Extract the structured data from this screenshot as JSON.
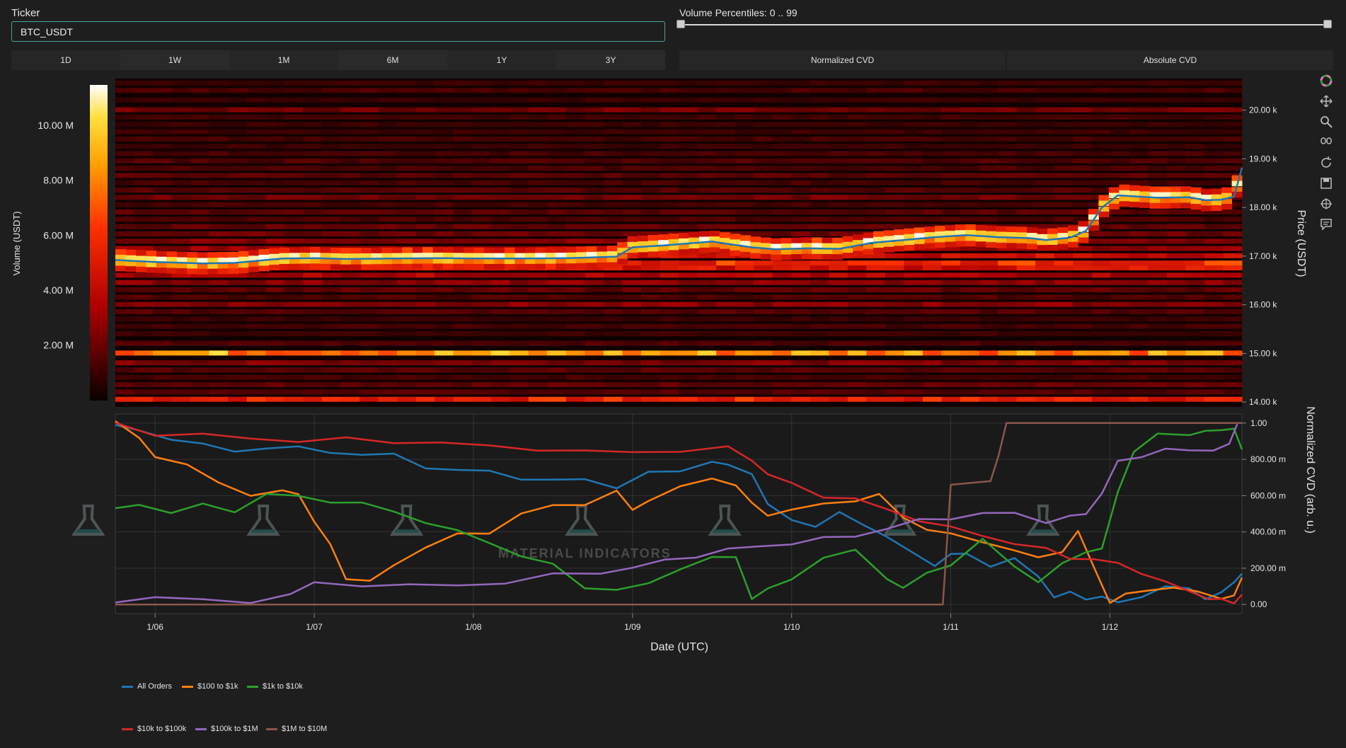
{
  "ticker": {
    "label": "Ticker",
    "value": "BTC_USDT"
  },
  "time_ranges": [
    "1D",
    "1W",
    "1M",
    "6M",
    "1Y",
    "3Y"
  ],
  "volume_percentiles": {
    "label": "Volume Percentiles: 0 .. 99",
    "min": 0,
    "max": 99
  },
  "cvd_modes": [
    "Normalized CVD",
    "Absolute CVD"
  ],
  "modebar_icons": [
    "plotly-logo-icon",
    "pan-icon",
    "zoom-icon",
    "autoscale-icon",
    "reset-icon",
    "download-icon",
    "spike-icon",
    "hover-icon"
  ],
  "colors": {
    "blue": "#1f77b4",
    "orange": "#ff7f0e",
    "green": "#2ca02c",
    "red": "#d62728",
    "purple": "#9467bd",
    "brown": "#8c564b"
  },
  "chart_data": [
    {
      "type": "heatmap",
      "colorbar_title": "Volume (USDT)",
      "colorbar_ticks": [
        "2.00 M",
        "4.00 M",
        "6.00 M",
        "8.00 M",
        "10.00 M"
      ],
      "colorbar_tick_values": [
        2,
        4,
        6,
        8,
        10
      ],
      "colorbar_range": [
        0,
        11.5
      ],
      "colorscale": "hot",
      "ylabel": "Price (USDT)",
      "y_ticks": [
        "14.00 k",
        "15.00 k",
        "16.00 k",
        "17.00 k",
        "18.00 k",
        "19.00 k",
        "20.00 k"
      ],
      "y_tick_values": [
        14000,
        15000,
        16000,
        17000,
        18000,
        19000,
        20000
      ],
      "ylim": [
        13900,
        20650
      ],
      "xlim": [
        5.75,
        12.83
      ],
      "price_line": {
        "color": "#1f77b4",
        "x": [
          5.75,
          6.0,
          6.3,
          6.5,
          6.7,
          6.8,
          7.0,
          7.2,
          7.5,
          7.8,
          8.0,
          8.3,
          8.6,
          8.9,
          9.0,
          9.2,
          9.5,
          9.75,
          9.9,
          10.1,
          10.3,
          10.5,
          10.7,
          10.9,
          11.1,
          11.3,
          11.5,
          11.6,
          11.75,
          11.85,
          11.95,
          12.05,
          12.3,
          12.5,
          12.6,
          12.7,
          12.78,
          12.83
        ],
        "y": [
          16920,
          16880,
          16850,
          16860,
          16920,
          16950,
          16960,
          16940,
          16950,
          16960,
          16950,
          16950,
          16960,
          16990,
          17180,
          17220,
          17300,
          17180,
          17140,
          17160,
          17150,
          17270,
          17330,
          17390,
          17430,
          17390,
          17370,
          17330,
          17380,
          17520,
          18000,
          18250,
          18200,
          18210,
          18150,
          18160,
          18220,
          18820
        ]
      },
      "bands": [
        {
          "y": 14050,
          "v": 5.5
        },
        {
          "y": 14200,
          "v": 1.5
        },
        {
          "y": 14350,
          "v": 1.8
        },
        {
          "y": 14500,
          "v": 1.2
        },
        {
          "y": 14650,
          "v": 1.6
        },
        {
          "y": 14800,
          "v": 2.4
        },
        {
          "y": 15000,
          "v": 8.5
        },
        {
          "y": 15200,
          "v": 1.4
        },
        {
          "y": 15400,
          "v": 1.0
        },
        {
          "y": 15550,
          "v": 1.2
        },
        {
          "y": 15700,
          "v": 1.0
        },
        {
          "y": 15850,
          "v": 1.5
        },
        {
          "y": 16000,
          "v": 2.6
        },
        {
          "y": 16150,
          "v": 1.4
        },
        {
          "y": 16300,
          "v": 1.8
        },
        {
          "y": 16450,
          "v": 2.6
        },
        {
          "y": 16600,
          "v": 3.4
        },
        {
          "y": 16750,
          "v": 4.6
        },
        {
          "y": 16850,
          "v": 5.8
        },
        {
          "y": 17000,
          "v": 4.2
        },
        {
          "y": 17150,
          "v": 2.8
        },
        {
          "y": 17300,
          "v": 2.4
        },
        {
          "y": 17450,
          "v": 2.0
        },
        {
          "y": 17600,
          "v": 1.8
        },
        {
          "y": 17750,
          "v": 1.4
        },
        {
          "y": 17900,
          "v": 1.6
        },
        {
          "y": 18050,
          "v": 1.2
        },
        {
          "y": 18200,
          "v": 2.2
        },
        {
          "y": 18350,
          "v": 1.5
        },
        {
          "y": 18500,
          "v": 1.2
        },
        {
          "y": 18650,
          "v": 1.6
        },
        {
          "y": 18800,
          "v": 1.3
        },
        {
          "y": 18950,
          "v": 1.4
        },
        {
          "y": 19100,
          "v": 1.2
        },
        {
          "y": 19250,
          "v": 1.0
        },
        {
          "y": 19400,
          "v": 1.2
        },
        {
          "y": 19550,
          "v": 1.0
        },
        {
          "y": 19700,
          "v": 1.0
        },
        {
          "y": 19850,
          "v": 1.1
        },
        {
          "y": 20000,
          "v": 2.2
        },
        {
          "y": 20200,
          "v": 1.0
        },
        {
          "y": 20400,
          "v": 1.3
        },
        {
          "y": 20550,
          "v": 1.0
        }
      ]
    },
    {
      "type": "line",
      "ylabel": "Normalized CVD (arb. u.)",
      "xlabel": "Date (UTC)",
      "x_ticks": [
        "1/06",
        "1/07",
        "1/08",
        "1/09",
        "1/10",
        "1/11",
        "1/12"
      ],
      "x_tick_values": [
        6,
        7,
        8,
        9,
        10,
        11,
        12
      ],
      "xlim": [
        5.75,
        12.83
      ],
      "y_ticks": [
        "0.00",
        "200.00 m",
        "400.00 m",
        "600.00 m",
        "800.00 m",
        "1.00"
      ],
      "y_tick_values": [
        0,
        0.2,
        0.4,
        0.6,
        0.8,
        1.0
      ],
      "ylim": [
        -0.05,
        1.05
      ],
      "series": [
        {
          "name": "All Orders",
          "color": "#1f77b4",
          "x": [
            5.75,
            5.9,
            6.1,
            6.3,
            6.5,
            6.7,
            6.9,
            7.1,
            7.3,
            7.5,
            7.7,
            7.9,
            8.1,
            8.3,
            8.5,
            8.7,
            8.9,
            9.1,
            9.3,
            9.5,
            9.6,
            9.75,
            9.85,
            10.0,
            10.15,
            10.3,
            10.45,
            10.6,
            10.75,
            10.9,
            11.0,
            11.1,
            11.25,
            11.4,
            11.55,
            11.65,
            11.75,
            11.85,
            11.95,
            12.05,
            12.2,
            12.35,
            12.5,
            12.6,
            12.7,
            12.78,
            12.83
          ],
          "y": [
            0.99,
            0.95,
            0.92,
            0.88,
            0.84,
            0.87,
            0.86,
            0.84,
            0.83,
            0.82,
            0.76,
            0.74,
            0.73,
            0.7,
            0.68,
            0.69,
            0.65,
            0.72,
            0.74,
            0.79,
            0.76,
            0.73,
            0.55,
            0.46,
            0.44,
            0.5,
            0.44,
            0.38,
            0.28,
            0.22,
            0.28,
            0.27,
            0.22,
            0.25,
            0.15,
            0.05,
            0.06,
            0.03,
            0.05,
            0.0,
            0.05,
            0.1,
            0.08,
            0.04,
            0.06,
            0.12,
            0.18
          ]
        },
        {
          "name": "$100 to $1k",
          "color": "#ff7f0e",
          "x": [
            5.75,
            5.9,
            6.0,
            6.2,
            6.4,
            6.6,
            6.8,
            6.9,
            7.0,
            7.1,
            7.2,
            7.35,
            7.5,
            7.7,
            7.9,
            8.1,
            8.3,
            8.5,
            8.7,
            8.9,
            9.0,
            9.1,
            9.3,
            9.5,
            9.65,
            9.75,
            9.85,
            10.0,
            10.2,
            10.4,
            10.55,
            10.7,
            10.85,
            11.0,
            11.2,
            11.4,
            11.55,
            11.7,
            11.8,
            11.9,
            12.0,
            12.1,
            12.25,
            12.4,
            12.55,
            12.7,
            12.78,
            12.83
          ],
          "y": [
            1.0,
            0.92,
            0.82,
            0.76,
            0.68,
            0.6,
            0.62,
            0.62,
            0.45,
            0.33,
            0.15,
            0.12,
            0.22,
            0.32,
            0.38,
            0.4,
            0.5,
            0.54,
            0.56,
            0.62,
            0.52,
            0.58,
            0.64,
            0.7,
            0.66,
            0.55,
            0.5,
            0.52,
            0.55,
            0.58,
            0.6,
            0.48,
            0.42,
            0.38,
            0.35,
            0.3,
            0.25,
            0.3,
            0.4,
            0.2,
            0.02,
            0.05,
            0.08,
            0.1,
            0.06,
            0.04,
            0.05,
            0.14
          ]
        },
        {
          "name": "$1k to $10k",
          "color": "#2ca02c",
          "x": [
            5.75,
            5.9,
            6.1,
            6.3,
            6.5,
            6.7,
            6.9,
            7.1,
            7.3,
            7.5,
            7.7,
            7.9,
            8.1,
            8.3,
            8.5,
            8.7,
            8.9,
            9.1,
            9.3,
            9.5,
            9.65,
            9.75,
            9.85,
            10.0,
            10.2,
            10.4,
            10.6,
            10.7,
            10.85,
            11.0,
            11.2,
            11.4,
            11.55,
            11.7,
            11.85,
            11.95,
            12.05,
            12.15,
            12.3,
            12.5,
            12.6,
            12.7,
            12.78,
            12.83
          ],
          "y": [
            0.52,
            0.56,
            0.5,
            0.55,
            0.52,
            0.6,
            0.6,
            0.57,
            0.55,
            0.52,
            0.45,
            0.4,
            0.35,
            0.26,
            0.22,
            0.1,
            0.07,
            0.12,
            0.2,
            0.25,
            0.27,
            0.03,
            0.08,
            0.15,
            0.25,
            0.3,
            0.15,
            0.08,
            0.18,
            0.22,
            0.35,
            0.22,
            0.12,
            0.22,
            0.3,
            0.3,
            0.62,
            0.85,
            0.93,
            0.94,
            0.96,
            0.95,
            0.98,
            0.85
          ]
        },
        {
          "name": "$10k to $100k",
          "color": "#d62728",
          "x": [
            5.75,
            6.0,
            6.3,
            6.6,
            6.9,
            7.2,
            7.5,
            7.8,
            8.1,
            8.4,
            8.7,
            9.0,
            9.3,
            9.6,
            9.75,
            9.85,
            10.0,
            10.2,
            10.4,
            10.6,
            10.8,
            11.0,
            11.2,
            11.4,
            11.6,
            11.75,
            11.9,
            12.05,
            12.2,
            12.35,
            12.5,
            12.62,
            12.7,
            12.78,
            12.83
          ],
          "y": [
            1.0,
            0.94,
            0.93,
            0.92,
            0.9,
            0.91,
            0.9,
            0.89,
            0.87,
            0.86,
            0.84,
            0.84,
            0.85,
            0.86,
            0.8,
            0.72,
            0.66,
            0.6,
            0.58,
            0.52,
            0.47,
            0.42,
            0.38,
            0.34,
            0.3,
            0.26,
            0.25,
            0.22,
            0.18,
            0.12,
            0.07,
            0.04,
            0.02,
            0.01,
            0.06
          ]
        },
        {
          "name": "$100k to $1M",
          "color": "#9467bd",
          "x": [
            5.75,
            6.0,
            6.3,
            6.6,
            6.85,
            7.0,
            7.3,
            7.6,
            7.9,
            8.2,
            8.5,
            8.8,
            9.0,
            9.2,
            9.4,
            9.6,
            9.8,
            10.0,
            10.2,
            10.4,
            10.6,
            10.8,
            11.0,
            11.2,
            11.4,
            11.6,
            11.75,
            11.85,
            11.95,
            12.05,
            12.2,
            12.35,
            12.5,
            12.65,
            12.75,
            12.8
          ],
          "y": [
            0.02,
            0.04,
            0.02,
            0.02,
            0.05,
            0.12,
            0.11,
            0.1,
            0.11,
            0.12,
            0.16,
            0.18,
            0.2,
            0.24,
            0.27,
            0.3,
            0.32,
            0.34,
            0.36,
            0.38,
            0.42,
            0.46,
            0.48,
            0.5,
            0.5,
            0.46,
            0.48,
            0.5,
            0.62,
            0.78,
            0.82,
            0.86,
            0.84,
            0.86,
            0.88,
            0.99
          ]
        },
        {
          "name": "$1M to $10M",
          "color": "#8c564b",
          "x": [
            5.75,
            10.95,
            11.0,
            11.25,
            11.3,
            11.35,
            12.83
          ],
          "y": [
            0.0,
            0.0,
            0.66,
            0.68,
            0.82,
            1.0,
            1.0
          ]
        }
      ]
    }
  ],
  "watermark": "MATERIAL INDICATORS"
}
